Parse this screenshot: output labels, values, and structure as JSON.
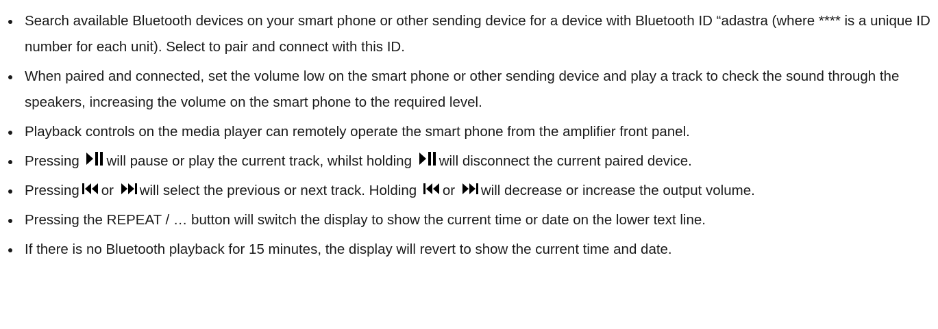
{
  "bullets": [
    {
      "text_a": "Search available Bluetooth devices on your smart phone or other sending device for a device with Bluetooth ID “adastra (where **** is a unique ID number for each unit). Select to pair and connect with this ID."
    },
    {
      "text_a": "When paired and connected, set the volume low on the smart phone or other sending device and play a track to check the sound through the speakers, increasing the volume on the smart phone to the required level."
    },
    {
      "text_a": "Playback controls on the media player can remotely operate the smart phone from the amplifier front panel."
    },
    {
      "text_a": "Pressing",
      "text_b": "will pause or play the current track, whilst holding",
      "text_c": "will disconnect the current paired device."
    },
    {
      "text_a": "Pressing",
      "text_b": "or",
      "text_c": "will select the previous or next track. Holding",
      "text_d": "or",
      "text_e": "will decrease or increase the output volume."
    },
    {
      "text_a": "Pressing the REPEAT / … button will switch the display to show the current time or date on the lower text line."
    },
    {
      "text_a": "If there is no Bluetooth playback for 15 minutes, the display will revert to show the current time and date."
    }
  ],
  "icons": {
    "play_pause": "play-pause-icon",
    "previous": "skip-previous-icon",
    "next": "skip-next-icon"
  },
  "colors": {
    "text": "#1a1a1a",
    "background": "#ffffff"
  }
}
